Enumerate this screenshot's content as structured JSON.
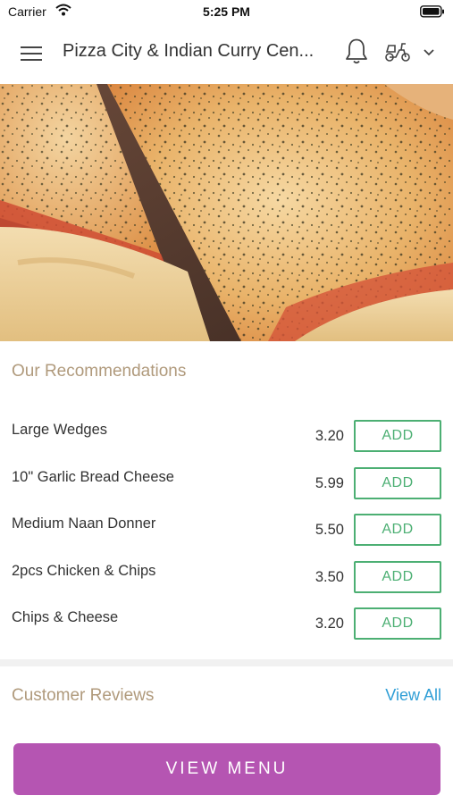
{
  "status_bar": {
    "carrier": "Carrier",
    "time": "5:25 PM"
  },
  "header": {
    "title": "Pizza City & Indian Curry Cen..."
  },
  "recommendations": {
    "title": "Our Recommendations",
    "items": [
      {
        "name": "Large Wedges",
        "price": "3.20",
        "add_label": "ADD"
      },
      {
        "name": "10\" Garlic Bread Cheese",
        "price": "5.99",
        "add_label": "ADD"
      },
      {
        "name": "Medium Naan Donner",
        "price": "5.50",
        "add_label": "ADD"
      },
      {
        "name": "2pcs Chicken & Chips",
        "price": "3.50",
        "add_label": "ADD"
      },
      {
        "name": "Chips & Cheese",
        "price": "3.20",
        "add_label": "ADD"
      }
    ]
  },
  "reviews": {
    "title": "Customer Reviews",
    "view_all": "View All"
  },
  "footer": {
    "view_menu": "VIEW MENU"
  },
  "colors": {
    "accent_purple": "#b555b2",
    "add_green": "#4caf73",
    "section_title": "#b09a7c",
    "link_blue": "#2f9ed6"
  },
  "icons": [
    "wifi-icon",
    "battery-icon",
    "hamburger-menu-icon",
    "bell-icon",
    "scooter-icon",
    "chevron-down-icon"
  ]
}
